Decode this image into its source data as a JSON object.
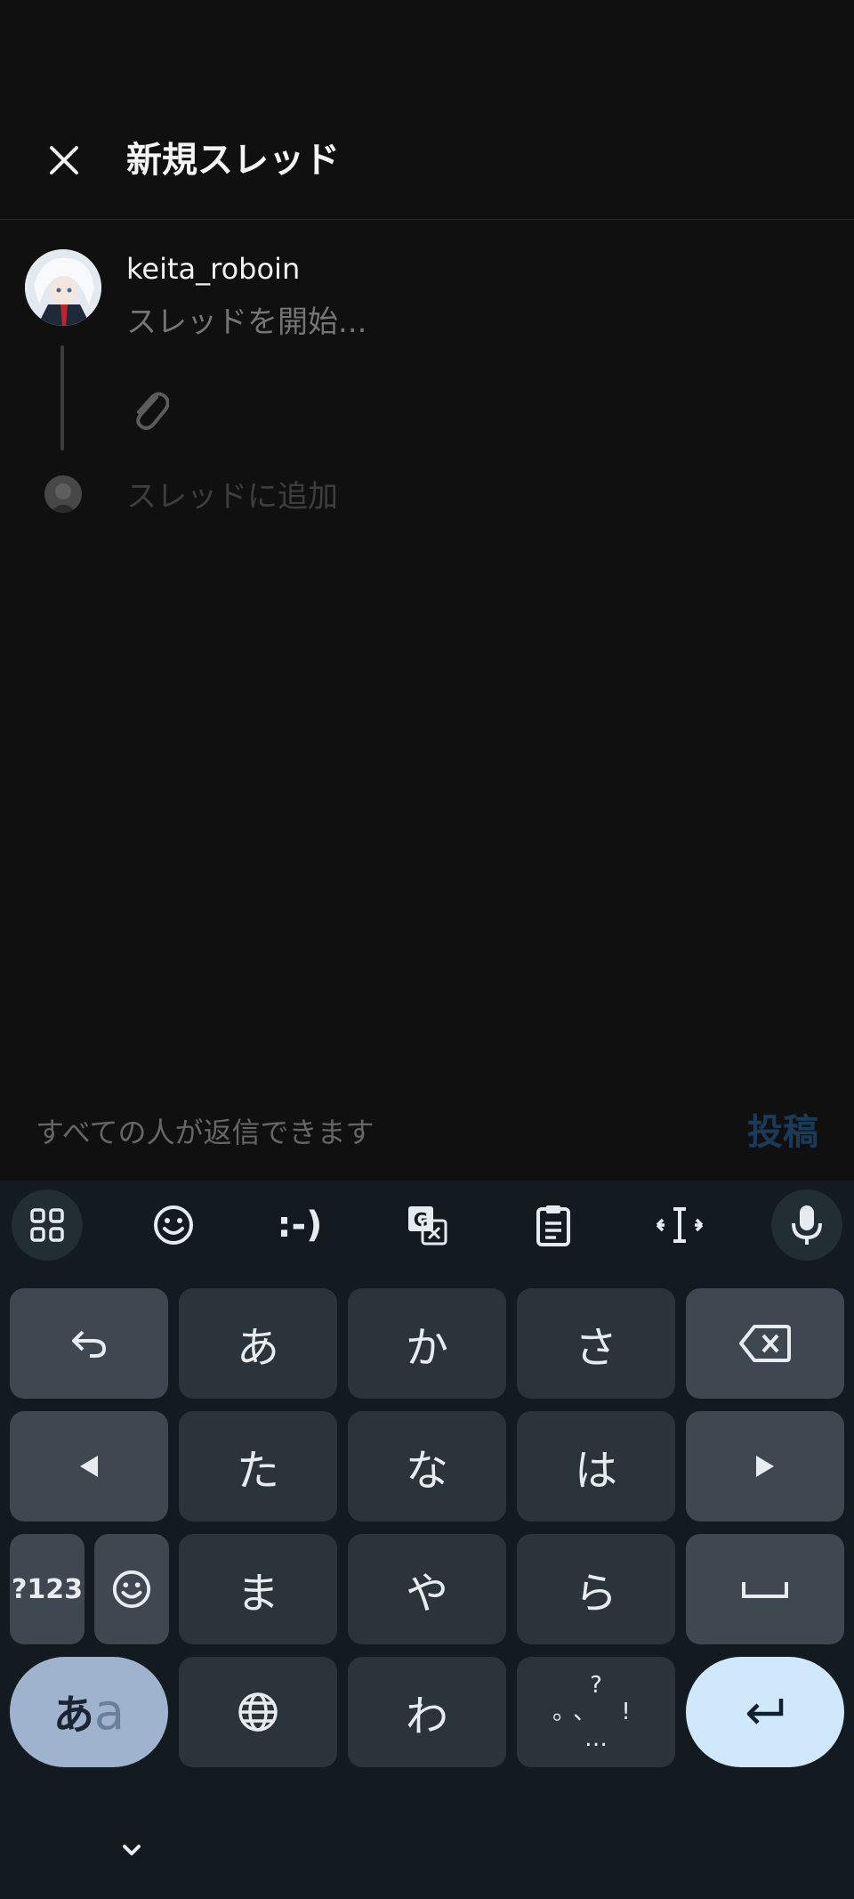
{
  "header": {
    "title": "新規スレッド"
  },
  "composer": {
    "username": "keita_roboin",
    "placeholder": "スレッドを開始...",
    "add_thread_placeholder": "スレッドに追加"
  },
  "footer": {
    "reply_setting": "すべての人が返信できます",
    "post_label": "投稿"
  },
  "keyboard": {
    "toolbar": {
      "emoticon": ":-)"
    },
    "rows": {
      "row1": [
        "あ",
        "か",
        "さ"
      ],
      "row2": [
        "た",
        "な",
        "は"
      ],
      "row3": [
        "ま",
        "や",
        "ら"
      ],
      "row4_wa": "わ"
    },
    "mode_key": {
      "a": "あ",
      "b": "a"
    },
    "numbers_key": "?123",
    "punct_key": {
      "top": "?",
      "middle": "。、 !",
      "bottom": "…"
    }
  },
  "colors": {
    "background": "#101010",
    "keyboard_bg": "#131b21",
    "key_bg": "#2b333b",
    "fn_key_bg": "#3f4850",
    "enter_key_bg": "#cfe8fb",
    "mode_key_bg": "#9fb3cf",
    "post_button": "#1a3a5a"
  }
}
